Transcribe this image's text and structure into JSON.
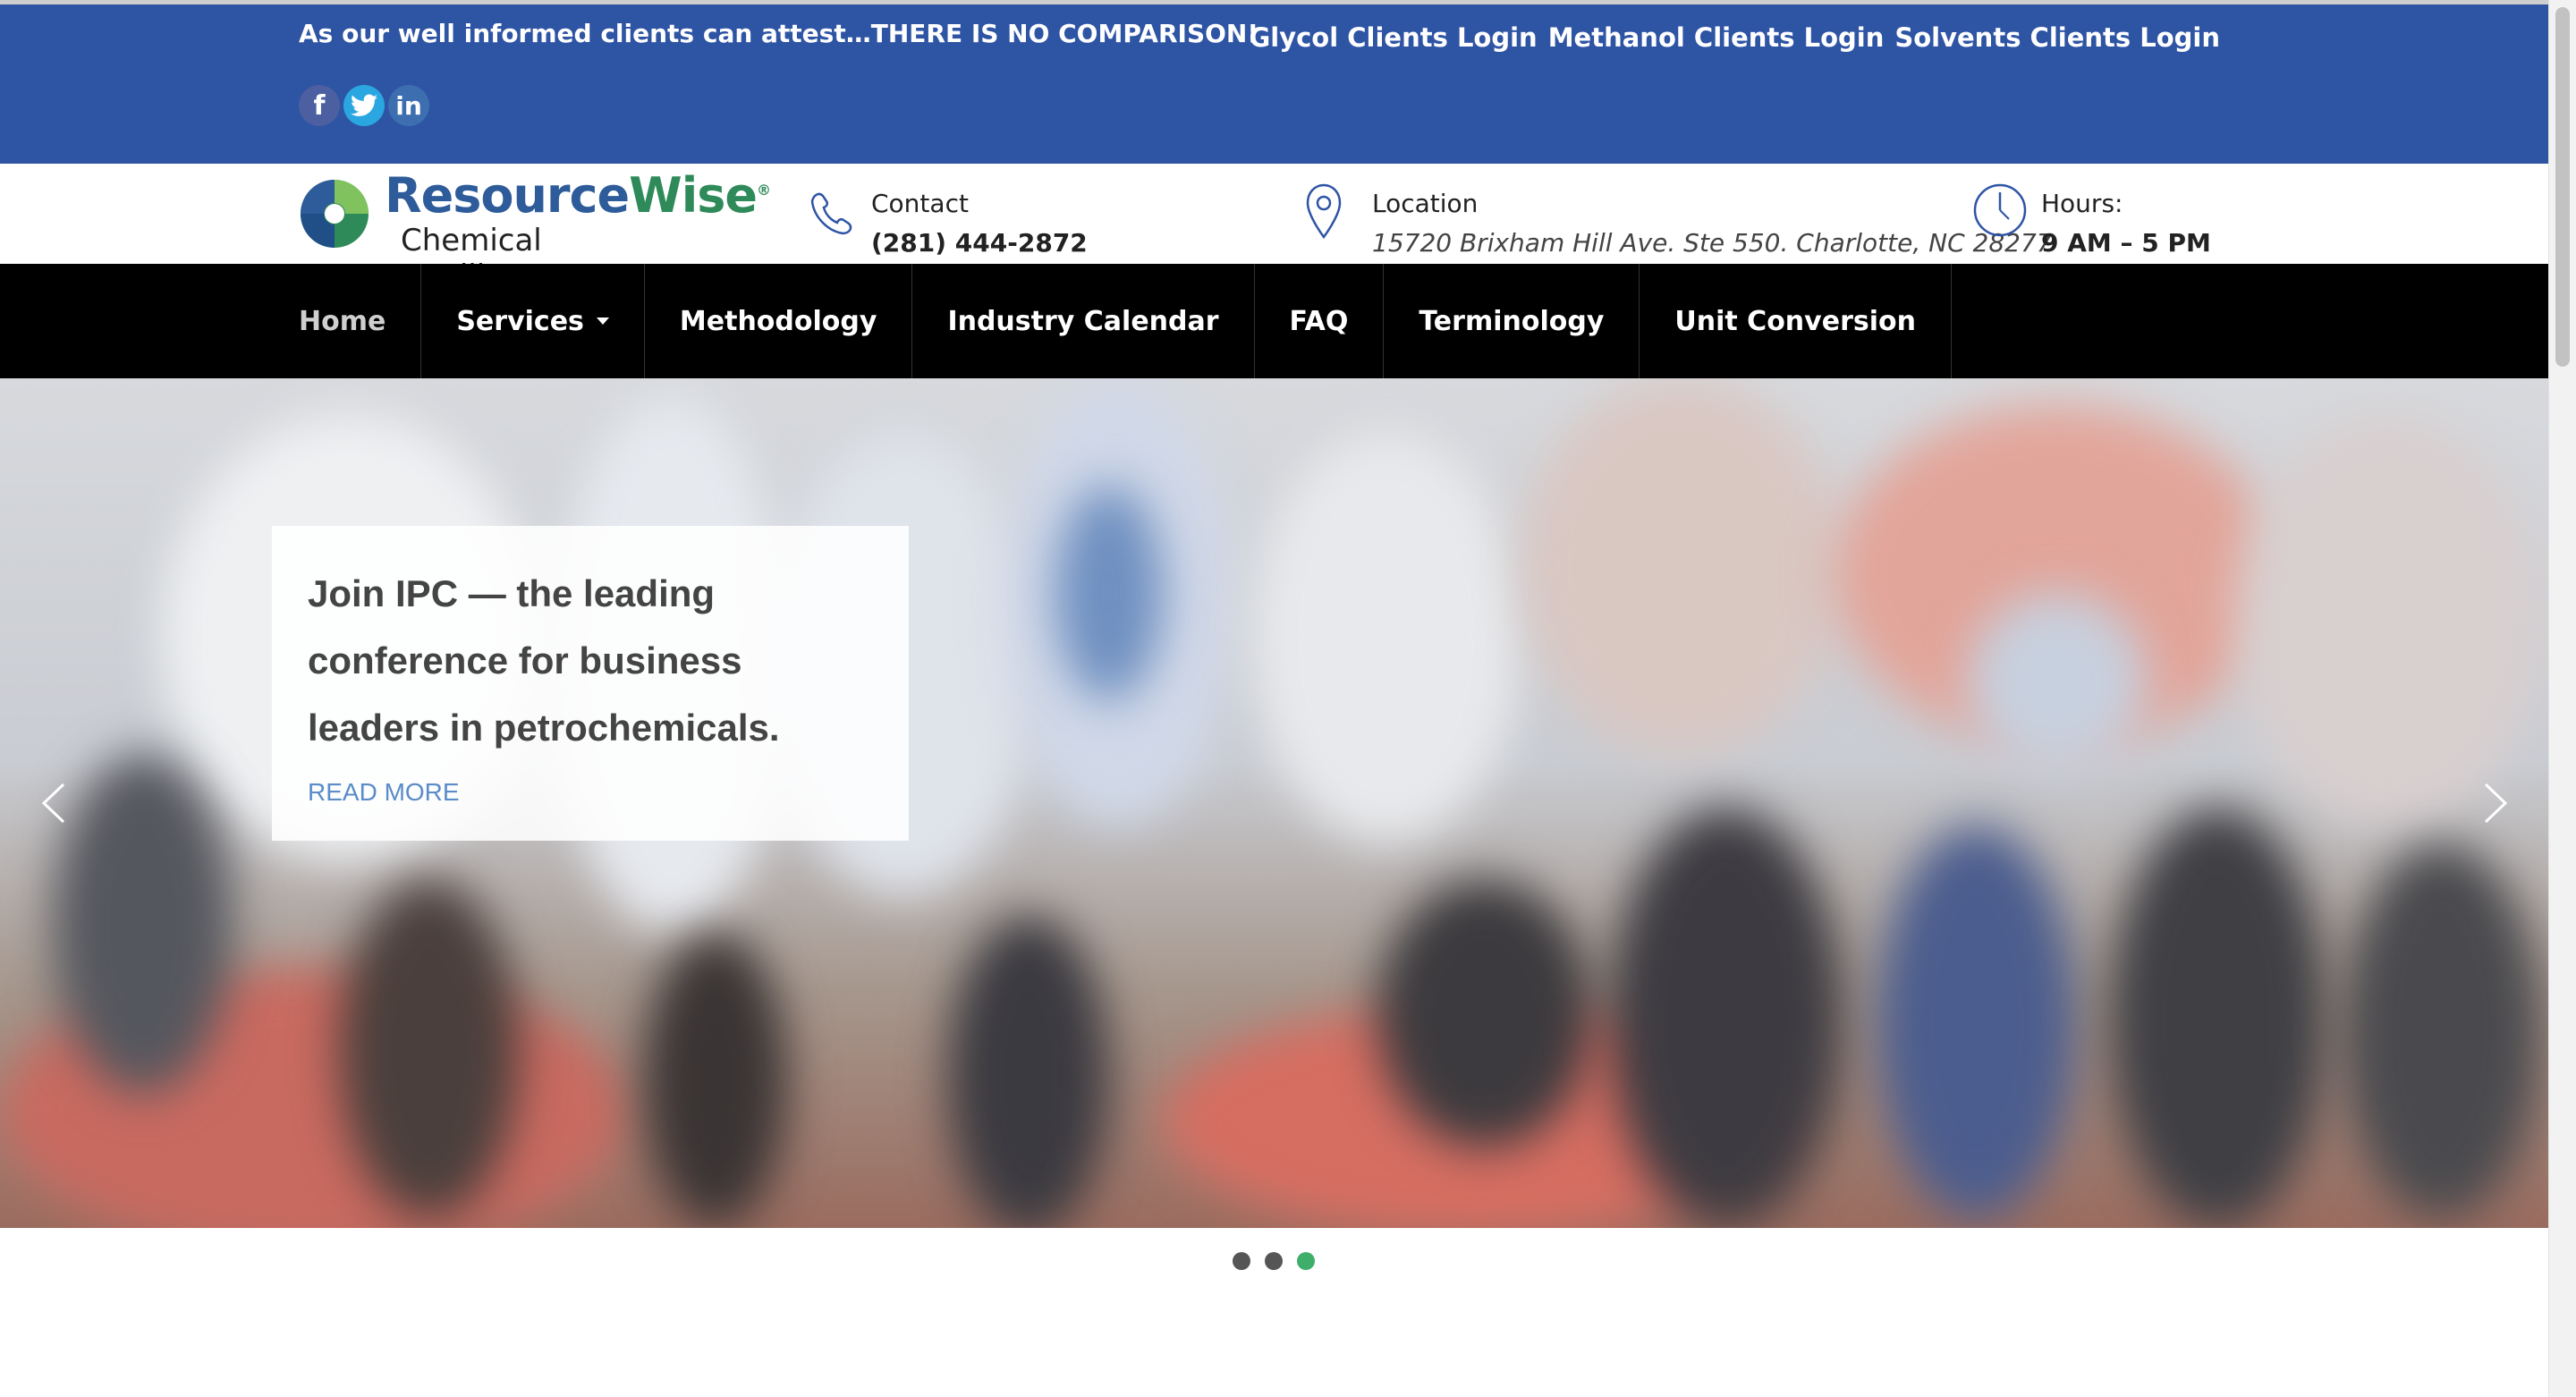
{
  "topbar": {
    "tagline": "As our well informed clients can attest…THERE IS NO COMPARISON!",
    "social": [
      "facebook-icon",
      "twitter-icon",
      "linkedin-icon"
    ],
    "logins": [
      "Glycol Clients Login",
      "Methanol Clients Login",
      "Solvents Clients Login"
    ],
    "color": "#2e54a4"
  },
  "header": {
    "logo_name_part1": "Resource",
    "logo_name_part2": "Wise",
    "logo_reg": "®",
    "logo_sub": "Chemical Intelligence",
    "contact": {
      "label": "Contact",
      "value": "(281) 444-2872",
      "icon": "phone-icon"
    },
    "location": {
      "label": "Location",
      "value": "15720 Brixham Hill Ave. Ste 550. Charlotte, NC 28277",
      "icon": "map-pin-icon"
    },
    "hours": {
      "label": "Hours:",
      "value": "9 AM – 5 PM",
      "icon": "clock-icon"
    }
  },
  "nav": {
    "items": [
      "Home",
      "Services",
      "Methodology",
      "Industry Calendar",
      "FAQ",
      "Terminology",
      "Unit Conversion"
    ],
    "active": "Home"
  },
  "hero": {
    "headline": "Join IPC — the leading conference for business leaders in petrochemicals.",
    "read_more": "READ MORE",
    "slide_count": 3,
    "active_slide": 3,
    "dot_active_color": "#3fae6a"
  }
}
